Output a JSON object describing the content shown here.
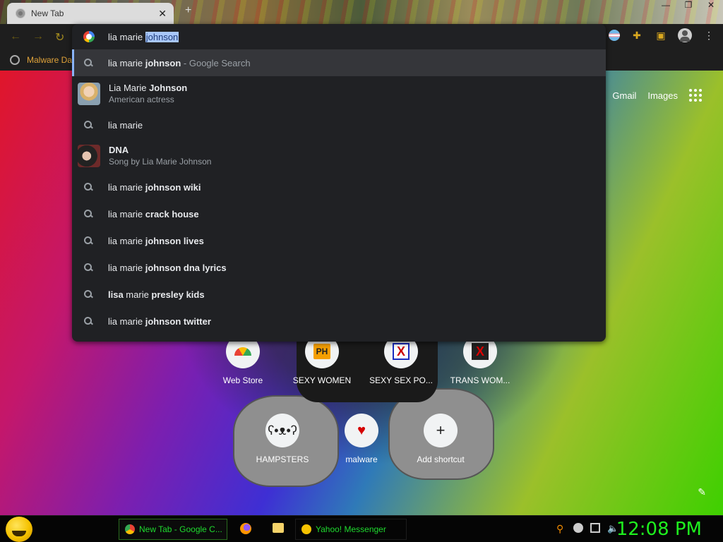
{
  "tab": {
    "title": "New Tab",
    "close": "✕",
    "new": "+"
  },
  "bookmarks": [
    {
      "label": "Malware Da"
    }
  ],
  "omnibox": {
    "typed": "lia marie ",
    "autocomplete_selected": "johnson",
    "suggestions": [
      {
        "type": "search",
        "pre": "lia marie ",
        "bold": "johnson",
        "post": "",
        "suffix": " - Google Search",
        "selected": true
      },
      {
        "type": "entity",
        "title_pre": "Lia Marie ",
        "title_bold": "Johnson",
        "subtitle": "American actress"
      },
      {
        "type": "search",
        "pre": "lia marie",
        "bold": "",
        "post": ""
      },
      {
        "type": "entity",
        "title_pre": "",
        "title_bold": "DNA",
        "subtitle": "Song by Lia Marie Johnson"
      },
      {
        "type": "search",
        "pre": "lia marie ",
        "bold": "johnson wiki",
        "post": ""
      },
      {
        "type": "search",
        "pre": "lia marie ",
        "bold": "crack house",
        "post": ""
      },
      {
        "type": "search",
        "pre": "lia marie ",
        "bold": "johnson lives",
        "post": ""
      },
      {
        "type": "search",
        "pre": "lia marie ",
        "bold": "johnson dna lyrics",
        "post": ""
      },
      {
        "type": "search",
        "pre": "",
        "bold": "lisa",
        "post": " marie ",
        "bold2": "presley kids"
      },
      {
        "type": "search",
        "pre": "lia marie ",
        "bold": "johnson twitter",
        "post": ""
      }
    ]
  },
  "ntp": {
    "links": {
      "gmail": "Gmail",
      "images": "Images"
    },
    "shortcuts_row1": [
      "Web Store",
      "SEXY WOMEN",
      "SEXY SEX PO...",
      "TRANS WOM..."
    ],
    "shortcuts_row2": [
      "HAMPSTERS",
      "malware",
      "Add shortcut"
    ],
    "icon_texts": {
      "ph": "PH",
      "x": "X",
      "plus": "+"
    }
  },
  "taskbar": {
    "chrome_task": "New Tab - Google C...",
    "yahoo_task": "Yahoo! Messenger",
    "clock": "12:08 PM"
  },
  "colors": {
    "accent_green": "#1ef01e",
    "omnibox_bg": "#202124",
    "selected_row": "#35363a"
  }
}
